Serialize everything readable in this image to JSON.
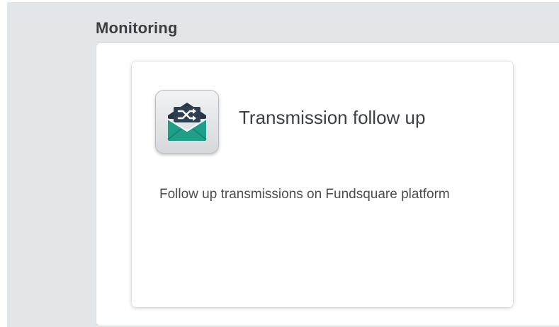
{
  "section": {
    "title": "Monitoring"
  },
  "card": {
    "title": "Transmission follow up",
    "description": "Follow up transmissions on Fundsquare platform",
    "icon": "envelope-shuffle-icon"
  },
  "colors": {
    "background": "#e3e6e9",
    "envelope_teal": "#1f9e8a",
    "envelope_dark": "#263646"
  }
}
